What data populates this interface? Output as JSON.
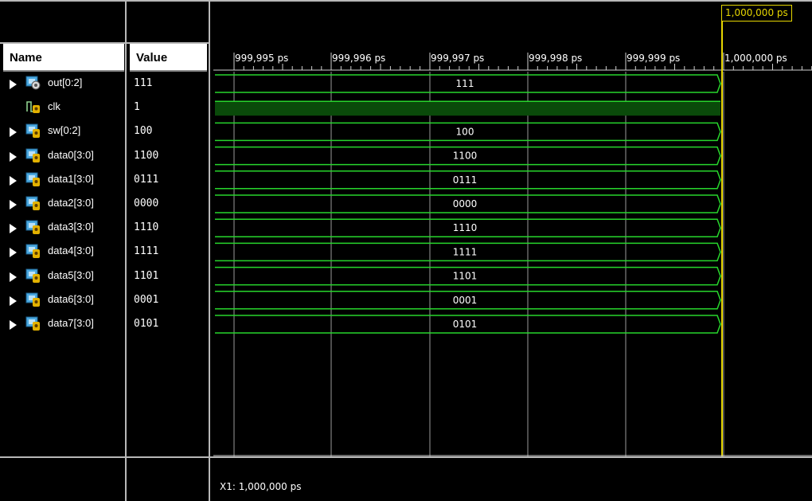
{
  "headers": {
    "name": "Name",
    "value": "Value"
  },
  "signals": [
    {
      "name": "out[0:2]",
      "value": "111",
      "kind": "bus",
      "icon": "output-bus-icon"
    },
    {
      "name": "clk",
      "value": "1",
      "kind": "bit",
      "icon": "clock-signal-icon"
    },
    {
      "name": "sw[0:2]",
      "value": "100",
      "kind": "bus",
      "icon": "input-bus-icon"
    },
    {
      "name": "data0[3:0]",
      "value": "1100",
      "kind": "bus",
      "icon": "input-bus-icon"
    },
    {
      "name": "data1[3:0]",
      "value": "0111",
      "kind": "bus",
      "icon": "input-bus-icon"
    },
    {
      "name": "data2[3:0]",
      "value": "0000",
      "kind": "bus",
      "icon": "input-bus-icon"
    },
    {
      "name": "data3[3:0]",
      "value": "1110",
      "kind": "bus",
      "icon": "input-bus-icon"
    },
    {
      "name": "data4[3:0]",
      "value": "1111",
      "kind": "bus",
      "icon": "input-bus-icon"
    },
    {
      "name": "data5[3:0]",
      "value": "1101",
      "kind": "bus",
      "icon": "input-bus-icon"
    },
    {
      "name": "data6[3:0]",
      "value": "0001",
      "kind": "bus",
      "icon": "input-bus-icon"
    },
    {
      "name": "data7[3:0]",
      "value": "0101",
      "kind": "bus",
      "icon": "input-bus-icon"
    }
  ],
  "timeline": {
    "ticks": [
      "999,995 ps",
      "999,996 ps",
      "999,997 ps",
      "999,998 ps",
      "999,999 ps",
      "1,000,000 ps"
    ]
  },
  "cursor": {
    "label": "1,000,000 ps",
    "color": "#e6d600"
  },
  "x1_readout": "X1: 1,000,000 ps",
  "colors": {
    "wave": "#27d62c",
    "clock_fill": "#0a4a0a",
    "grid": "#9a9a9a",
    "background": "#000000"
  }
}
